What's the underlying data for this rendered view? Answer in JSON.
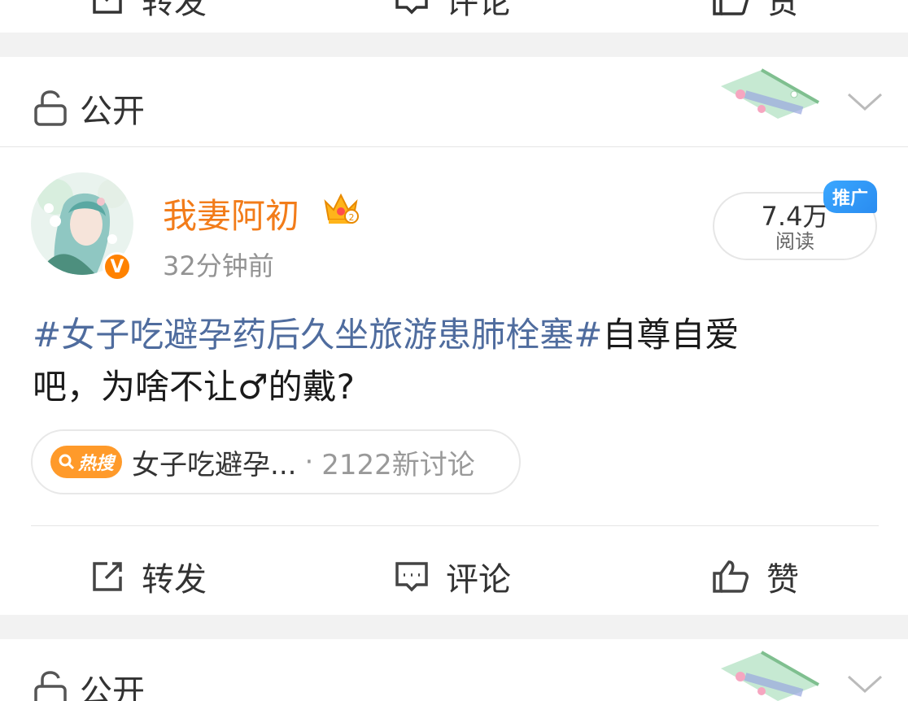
{
  "actions": {
    "repost": "转发",
    "comment": "评论",
    "like": "赞"
  },
  "visibility": {
    "label": "公开"
  },
  "post": {
    "username": "我妻阿初",
    "time": "32分钟前",
    "reads": {
      "count": "7.4万",
      "label": "阅读"
    },
    "promo_tag": "推广",
    "text": {
      "hashtag": "#女子吃避孕药后久坐旅游患肺栓塞#",
      "line1_rest": "自尊自爱",
      "line2": "吧，为啥不让♂的戴?"
    },
    "hot_search": {
      "badge": "热搜",
      "title": "女子吃避孕...",
      "separator": "·",
      "count": "2122新讨论"
    }
  },
  "colors": {
    "username": "#f27c1a",
    "hashtag": "#4f6c9e",
    "hot_badge": "#ff9a2a",
    "promo_tag": "#2a8cf0",
    "verify_badge": "#ff8200"
  },
  "icons": [
    "repost-icon",
    "comment-icon",
    "like-icon",
    "lock-open-icon",
    "chevron-down-icon",
    "crown-icon",
    "search-icon"
  ]
}
